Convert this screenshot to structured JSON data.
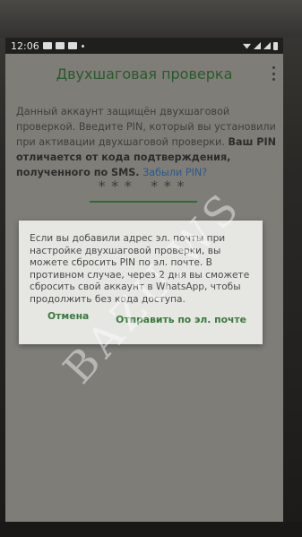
{
  "status_bar": {
    "time": "12:06"
  },
  "app_bar": {
    "title": "Двухшаговая проверка"
  },
  "description": {
    "part1": "Данный аккаунт защищён двухшаговой проверкой. Введите PIN, который вы установили при активации двухшаговой проверки. ",
    "bold": "Ваш PIN отличается от кода подтверждения, полученного по SMS.",
    "link": " Забыли PIN?"
  },
  "pin_field": {
    "value": "*** ***"
  },
  "dialog": {
    "message": "Если вы добавили адрес эл. почты при настройке двухшаговой проверки, вы можете сбросить PIN по эл. почте. В противном случае, через 2 дня вы сможете сбросить свой аккаунт в WhatsApp, чтобы продолжить без кода доступа.",
    "cancel_label": "Отмена",
    "email_label": "Отправить по эл. почте"
  },
  "watermark": {
    "text": "BAZU.WS"
  },
  "colors": {
    "accent_green": "#2f6a34",
    "dialog_bg": "#e6e6e3",
    "screen_dim": "#7e7d78"
  }
}
